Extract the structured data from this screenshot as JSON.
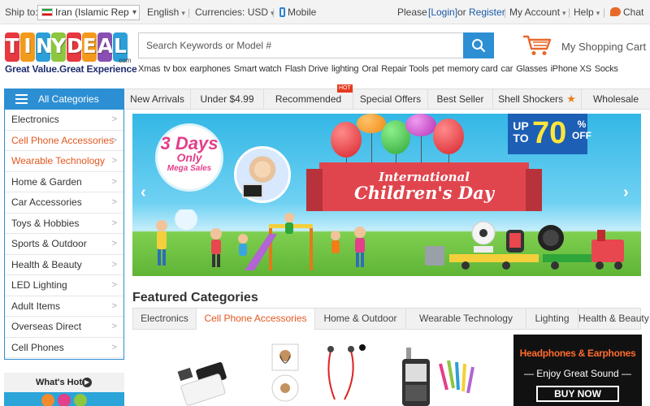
{
  "topbar": {
    "ship_label": "Ship to:",
    "ship_value": "Iran (Islamic Rep",
    "language": "English",
    "currencies": "Currencies: USD",
    "mobile": "Mobile",
    "please": "Please",
    "login": "[Login]",
    "or": "or",
    "register": "Register",
    "sep": "|",
    "my_account": "My Account",
    "help": "Help",
    "chat": "Chat"
  },
  "logo": {
    "letters": [
      "T",
      "I",
      "N",
      "Y",
      "D",
      "E",
      "A",
      "L"
    ],
    "letter_colors": [
      "#e7373f",
      "#f39a1c",
      "#2c9fd8",
      "#8dc63f",
      "#e7373f",
      "#f39a1c",
      "#8a4fb3",
      "#2c9fd8"
    ],
    "dotcom": ".com",
    "tagline": "Great Value.Great Experience"
  },
  "search": {
    "placeholder": "Search Keywords or Model #",
    "hot_keywords": [
      "Xmas",
      "tv box",
      "earphones",
      "Smart watch",
      "Flash Drive",
      "lighting",
      "Oral",
      "Repair Tools",
      "pet",
      "memory card",
      "car",
      "Glasses",
      "iPhone XS",
      "Socks"
    ]
  },
  "cart": {
    "label": "My Shopping Cart"
  },
  "nav": {
    "all_categories": "All Categories",
    "items": [
      "New Arrivals",
      "Under $4.99",
      "Recommended",
      "Special Offers",
      "Best Seller",
      "Shell Shockers",
      "Wholesale"
    ],
    "hot_tag": "HOT"
  },
  "sidebar": {
    "items": [
      "Electronics",
      "Cell Phone Accessories",
      "Wearable Technology",
      "Home & Garden",
      "Car Accessories",
      "Toys & Hobbies",
      "Sports & Outdoor",
      "Health & Beauty",
      "LED Lighting",
      "Adult Items",
      "Overseas Direct",
      "Cell Phones"
    ],
    "arrow": ">",
    "whats_hot": "What's Hot"
  },
  "banner": {
    "days_num": "3",
    "days_word": "Days",
    "days_only": "Only",
    "mega": "Mega Sales",
    "ribbon_line1": "International",
    "ribbon_line2": "Children's Day",
    "offer_up_to": "UP TO",
    "offer_pct": "70",
    "offer_sym": "%",
    "offer_off": "OFF",
    "prev": "‹",
    "next": "›"
  },
  "featured": {
    "title": "Featured Categories",
    "tabs": [
      "Electronics",
      "Cell Phone Accessories",
      "Home & Outdoor",
      "Wearable Technology",
      "Lighting",
      "Health & Beauty"
    ],
    "active_tab": 1
  },
  "ad": {
    "title": "Headphones & Earphones",
    "subtitle": "— Enjoy Great Sound —",
    "button": "BUY NOW"
  },
  "colors": {
    "brand_blue": "#2d8fd3",
    "accent_orange": "#e2571e"
  },
  "icons": [
    "flag-iran-icon",
    "chevron-down-icon",
    "phone-icon",
    "chat-icon",
    "search-icon",
    "cart-icon",
    "hamburger-icon",
    "star-icon"
  ]
}
